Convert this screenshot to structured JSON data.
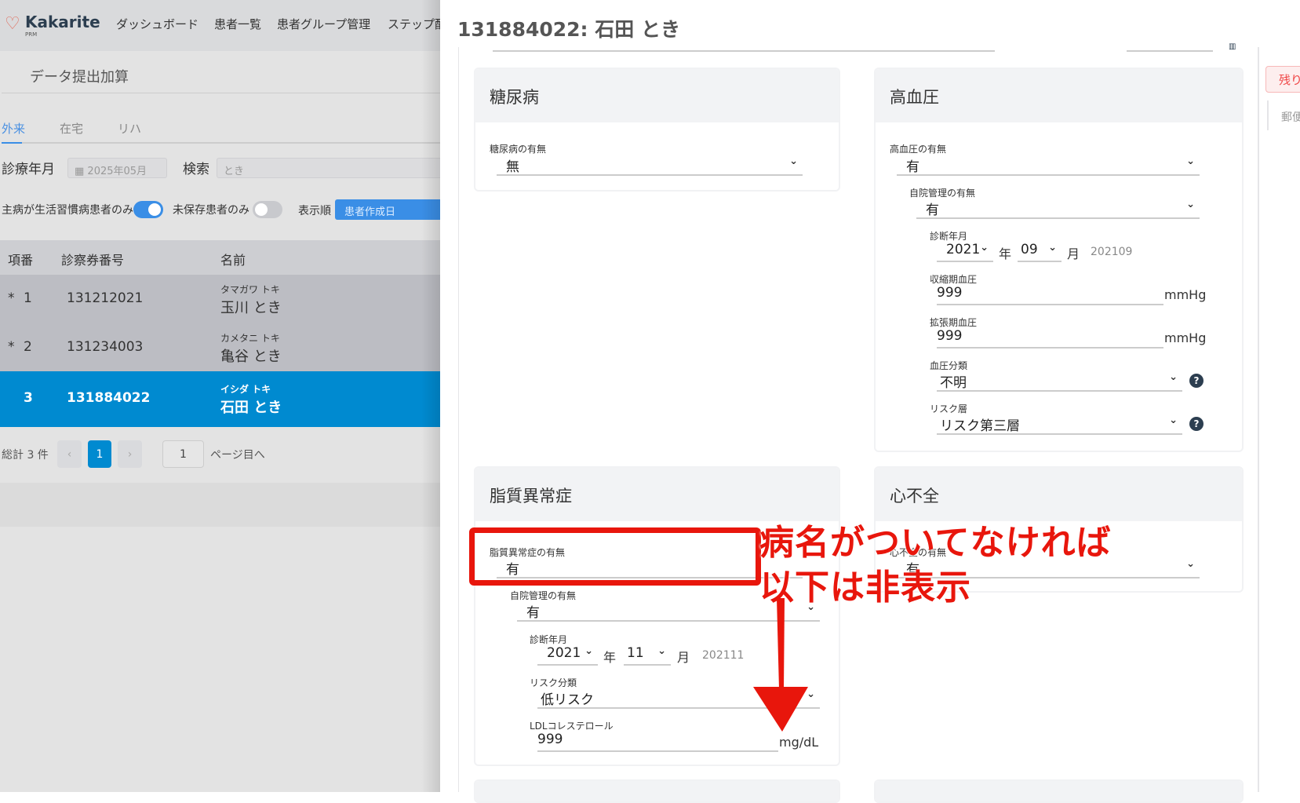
{
  "app": {
    "logo": "Kakarite",
    "logo_sub": "PRM",
    "nav": [
      "ダッシュボード",
      "患者一覧",
      "患者グループ管理",
      "ステップ配"
    ]
  },
  "page": {
    "title": "データ提出加算",
    "tabs": [
      "外来",
      "在宅",
      "リハ"
    ],
    "active_tab": "外来"
  },
  "filters": {
    "month_label": "診療年月",
    "month_value": "2025年05月",
    "search_label": "検索",
    "search_value": "とき",
    "toggle1_label": "主病が生活習慣病患者のみ",
    "toggle1_on": true,
    "toggle2_label": "未保存患者のみ",
    "toggle2_on": false,
    "sort_label": "表示順",
    "sort_button": "患者作成日"
  },
  "table": {
    "headers": [
      "項番",
      "診察券番号",
      "名前"
    ],
    "rows": [
      {
        "mark": "*",
        "no": "1",
        "card": "131212021",
        "kana": "タマガワ トキ",
        "name": "玉川 とき"
      },
      {
        "mark": "*",
        "no": "2",
        "card": "131234003",
        "kana": "カメタニ トキ",
        "name": "亀谷 とき"
      },
      {
        "mark": "",
        "no": "3",
        "card": "131884022",
        "kana": "イシダ トキ",
        "name": "石田 とき",
        "selected": true
      }
    ]
  },
  "pagination": {
    "total": "総計 3 件",
    "prev": "‹",
    "page": "1",
    "next": "›",
    "goto_value": "1",
    "goto_label": "ページ目へ"
  },
  "drawer": {
    "title": "131884022: 石田 とき",
    "side_button": "残り",
    "side_label": "郵便",
    "diabetes": {
      "title": "糖尿病",
      "presence_label": "糖尿病の有無",
      "presence": "無"
    },
    "hypertension": {
      "title": "高血圧",
      "presence_label": "高血圧の有無",
      "presence": "有",
      "mgmt_label": "自院管理の有無",
      "mgmt": "有",
      "diag_label": "診断年月",
      "year": "2021",
      "year_unit": "年",
      "month": "09",
      "month_unit": "月",
      "ym": "202109",
      "sys_label": "収縮期血圧",
      "sys": "999",
      "sys_unit": "mmHg",
      "dia_label": "拡張期血圧",
      "dia": "999",
      "dia_unit": "mmHg",
      "class_label": "血圧分類",
      "class": "不明",
      "risk_label": "リスク層",
      "risk": "リスク第三層"
    },
    "dyslipidemia": {
      "title": "脂質異常症",
      "presence_label": "脂質異常症の有無",
      "presence": "有",
      "mgmt_label": "自院管理の有無",
      "mgmt": "有",
      "diag_label": "診断年月",
      "year": "2021",
      "year_unit": "年",
      "month": "11",
      "month_unit": "月",
      "ym": "202111",
      "risk_label": "リスク分類",
      "risk": "低リスク",
      "ldl_label": "LDLコレステロール",
      "ldl": "999",
      "ldl_unit": "mg/dL"
    },
    "heart_failure": {
      "title": "心不全",
      "presence_label": "心不全の有無",
      "presence": "有"
    }
  },
  "annotation": {
    "line1": "病名がついてなければ",
    "line2": "以下は非表示",
    "color": "#e8160c"
  }
}
